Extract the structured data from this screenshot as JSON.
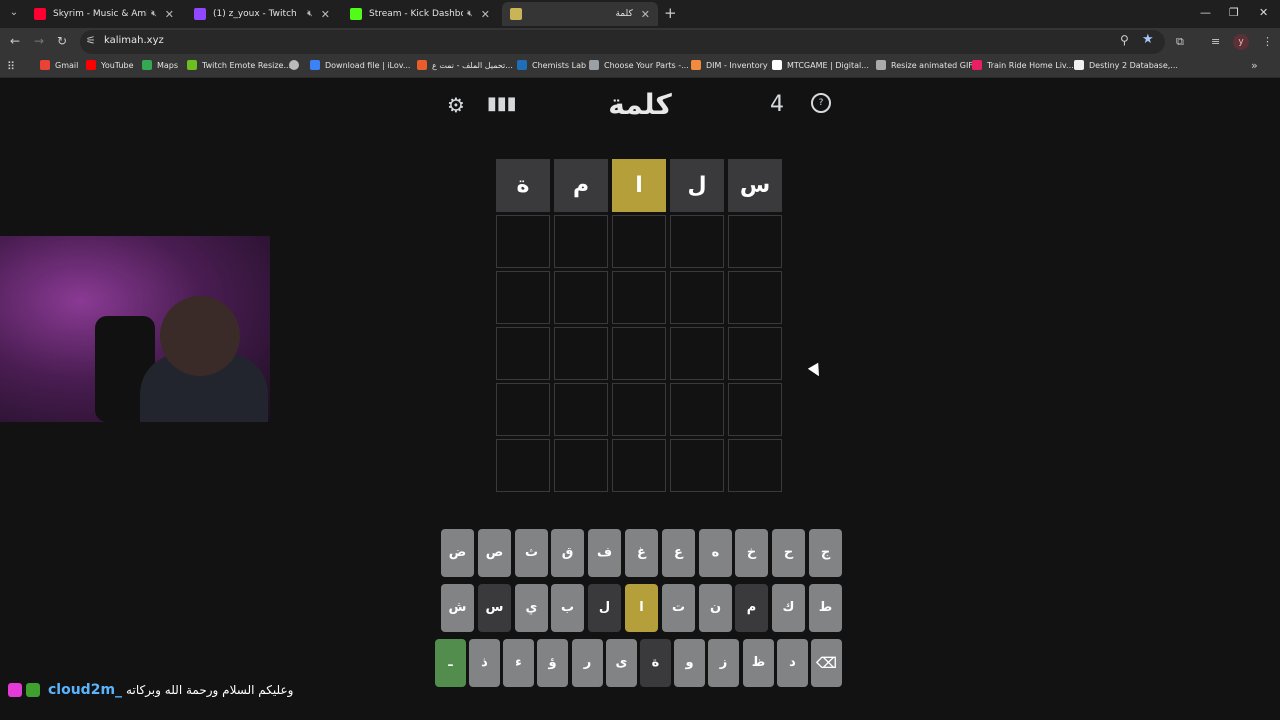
{
  "browser": {
    "tabs": [
      {
        "title": "Skyrim - Music & Ambience",
        "favicon_color": "#ff0033",
        "active": false,
        "muted": true
      },
      {
        "title": "(1) z_youx - Twitch",
        "favicon_color": "#9146ff",
        "active": false,
        "muted": true
      },
      {
        "title": "Stream - Kick Dashboard",
        "favicon_color": "#53fc18",
        "active": false,
        "muted": true
      },
      {
        "title": "كلمة",
        "favicon_color": "#c9b458",
        "active": true,
        "muted": false
      }
    ],
    "url": "kalimah.xyz",
    "profile_initial": "y",
    "bookmarks": [
      {
        "label": "Gmail",
        "color": "#ea4335"
      },
      {
        "label": "YouTube",
        "color": "#ff0000"
      },
      {
        "label": "Maps",
        "color": "#34a853"
      },
      {
        "label": "Twitch Emote Resize...",
        "color": "#6bc01f"
      },
      {
        "label": "",
        "color": "#bbbbbb"
      },
      {
        "label": "Download file | iLov...",
        "color": "#3b82f6"
      },
      {
        "label": "تحميل الملف - نمت ع...",
        "color": "#e85d2a"
      },
      {
        "label": "Chemists Lab",
        "color": "#1e6fb8"
      },
      {
        "label": "Choose Your Parts -...",
        "color": "#9aa0a6"
      },
      {
        "label": "DIM - Inventory",
        "color": "#f28b3d"
      },
      {
        "label": "MTCGAME | Digital...",
        "color": "#ffffff"
      },
      {
        "label": "Resize animated GIF",
        "color": "#aaaaaa"
      },
      {
        "label": "Train Ride Home Liv...",
        "color": "#e91e63"
      },
      {
        "label": "Destiny 2 Database,...",
        "color": "#f1f1f1"
      }
    ]
  },
  "game": {
    "title": "كلمة",
    "streak": "4",
    "colors": {
      "absent": "#3a3a3c",
      "present": "#b59f3b",
      "correct": "#538d4e",
      "key": "#818384"
    },
    "board": [
      [
        {
          "letter": "س",
          "state": "absent"
        },
        {
          "letter": "ل",
          "state": "absent"
        },
        {
          "letter": "ا",
          "state": "present"
        },
        {
          "letter": "م",
          "state": "absent"
        },
        {
          "letter": "ة",
          "state": "absent"
        }
      ],
      [
        {
          "letter": ""
        },
        {
          "letter": ""
        },
        {
          "letter": ""
        },
        {
          "letter": ""
        },
        {
          "letter": ""
        }
      ],
      [
        {
          "letter": ""
        },
        {
          "letter": ""
        },
        {
          "letter": ""
        },
        {
          "letter": ""
        },
        {
          "letter": ""
        }
      ],
      [
        {
          "letter": ""
        },
        {
          "letter": ""
        },
        {
          "letter": ""
        },
        {
          "letter": ""
        },
        {
          "letter": ""
        }
      ],
      [
        {
          "letter": ""
        },
        {
          "letter": ""
        },
        {
          "letter": ""
        },
        {
          "letter": ""
        },
        {
          "letter": ""
        }
      ],
      [
        {
          "letter": ""
        },
        {
          "letter": ""
        },
        {
          "letter": ""
        },
        {
          "letter": ""
        },
        {
          "letter": ""
        }
      ]
    ],
    "keyboard": [
      [
        {
          "label": "ج"
        },
        {
          "label": "ح"
        },
        {
          "label": "خ"
        },
        {
          "label": "ه"
        },
        {
          "label": "ع"
        },
        {
          "label": "غ"
        },
        {
          "label": "ف"
        },
        {
          "label": "ق"
        },
        {
          "label": "ث"
        },
        {
          "label": "ص"
        },
        {
          "label": "ض"
        }
      ],
      [
        {
          "label": "ط"
        },
        {
          "label": "ك"
        },
        {
          "label": "م",
          "state": "absent"
        },
        {
          "label": "ن"
        },
        {
          "label": "ت"
        },
        {
          "label": "ا",
          "state": "present"
        },
        {
          "label": "ل",
          "state": "absent"
        },
        {
          "label": "ب"
        },
        {
          "label": "ي"
        },
        {
          "label": "س",
          "state": "absent"
        },
        {
          "label": "ش"
        }
      ],
      [
        {
          "label": "⌫",
          "kind": "backspace"
        },
        {
          "label": "د"
        },
        {
          "label": "ظ"
        },
        {
          "label": "ز"
        },
        {
          "label": "و"
        },
        {
          "label": "ة",
          "state": "absent"
        },
        {
          "label": "ى"
        },
        {
          "label": "ر"
        },
        {
          "label": "ؤ"
        },
        {
          "label": "ء"
        },
        {
          "label": "ذ"
        },
        {
          "label": "ـ",
          "kind": "enter"
        }
      ]
    ]
  },
  "chat": {
    "username": "cloud2m_",
    "message": "وعليكم السلام ورحمة الله وبركاته"
  }
}
